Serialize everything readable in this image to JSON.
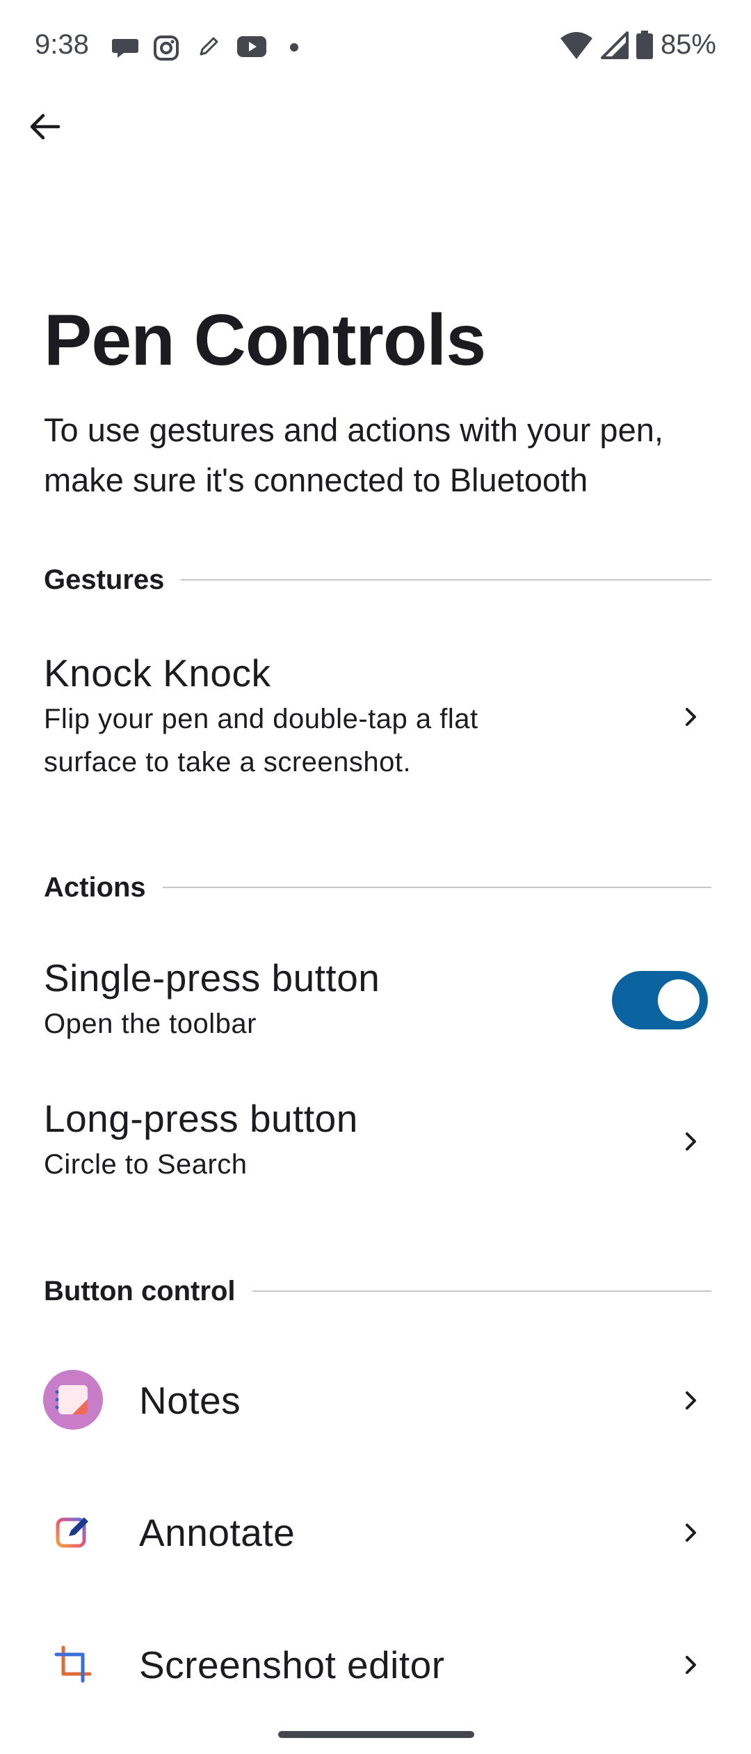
{
  "status_bar": {
    "time": "9:38",
    "battery": "85%",
    "notification_icons": [
      "chat-bubble-icon",
      "instagram-icon",
      "pen-icon",
      "youtube-icon",
      "dot-icon"
    ],
    "system_icons": [
      "wifi-icon",
      "signal-icon",
      "battery-icon"
    ]
  },
  "header": {
    "back_icon": "arrow-left-icon"
  },
  "page": {
    "title": "Pen Controls",
    "description": "To use gestures and actions with your pen, make sure it's connected to Bluetooth"
  },
  "sections": {
    "gestures": {
      "label": "Gestures",
      "knock_knock": {
        "title": "Knock Knock",
        "subtitle_line1": "Flip your pen and double-tap a flat",
        "subtitle_line2": "surface to take a screenshot."
      }
    },
    "actions": {
      "label": "Actions",
      "single_press": {
        "title": "Single-press button",
        "subtitle": "Open the toolbar",
        "enabled": true
      },
      "long_press": {
        "title": "Long-press button",
        "subtitle": "Circle to Search"
      }
    },
    "button_control": {
      "label": "Button control",
      "items": [
        {
          "label": "Notes",
          "icon": "notes-app-icon"
        },
        {
          "label": "Annotate",
          "icon": "annotate-icon"
        },
        {
          "label": "Screenshot editor",
          "icon": "crop-icon"
        }
      ]
    }
  },
  "colors": {
    "accent": "#0b64a0",
    "text": "#1c1b1f",
    "divider": "#c4c6cc"
  }
}
